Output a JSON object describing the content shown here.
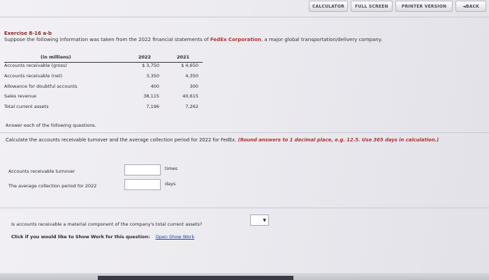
{
  "toolbar": {
    "calculator": "CALCULATOR",
    "full_screen": "FULL SCREEN",
    "printer_version": "PRINTER VERSION",
    "back": "◄BACK"
  },
  "exercise": {
    "title": "Exercise 8-16 a-b",
    "intro_before": "Suppose the following information was taken from the 2022 financial statements of ",
    "company": "FedEx Corporation",
    "intro_after": ", a major global transportation/delivery company."
  },
  "table": {
    "header": [
      "(in millions)",
      "2022",
      "2021"
    ],
    "rows": [
      [
        "Accounts receivable (gross)",
        "$ 3,750",
        "$ 4,650"
      ],
      [
        "Accounts receivable (net)",
        "3,350",
        "4,350"
      ],
      [
        "Allowance for doubtful accounts",
        "400",
        "300"
      ],
      [
        "Sales revenue",
        "38,115",
        "40,615"
      ],
      [
        "Total current assets",
        "7,196",
        "7,262"
      ]
    ]
  },
  "answer_note": "Answer each of the following questions.",
  "question1": {
    "text": "Calculate the accounts receivable turnover and the average collection period for 2022 for FedEx. ",
    "instruction": "(Round answers to 1 decimal place, e.g. 12.5. Use 365 days in calculation.)",
    "turnover_label": "Accounts receivable turnover",
    "turnover_unit": "times",
    "period_label": "The average collection period for 2022",
    "period_unit": "days"
  },
  "question2": {
    "text": "Is accounts receivable a material component of the company's total current assets?",
    "select_arrow": "▼"
  },
  "show_work": {
    "text": "Click if you would like to Show Work for this question:",
    "link": "Open Show Work"
  }
}
